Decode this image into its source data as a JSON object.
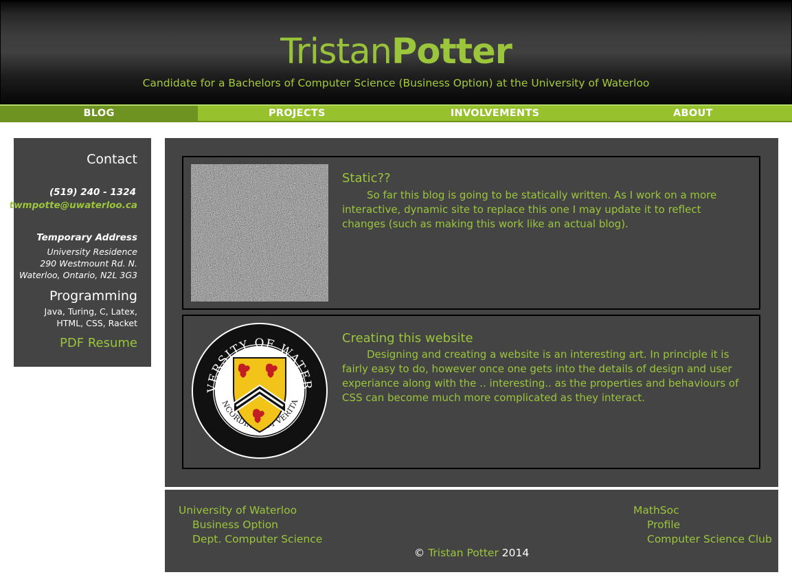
{
  "header": {
    "title_first": "Tristan",
    "title_last": "Potter",
    "tagline": "Candidate for a Bachelors of Computer Science (Business Option) at the University of Waterloo"
  },
  "nav": {
    "items": [
      {
        "label": "BLOG",
        "active": true
      },
      {
        "label": "PROJECTS",
        "active": false
      },
      {
        "label": "INVOLVEMENTS",
        "active": false
      },
      {
        "label": "ABOUT",
        "active": false
      }
    ]
  },
  "sidebar": {
    "contact_heading": "Contact",
    "phone": "(519) 240 - 1324",
    "email": "twmpotte@uwaterloo.ca",
    "address_heading": "Temporary Address",
    "address_lines": [
      "University Residence",
      "290 Westmount Rd. N.",
      "Waterloo, Ontario, N2L 3G3"
    ],
    "programming_heading": "Programming",
    "programming_text": "Java, Turing, C, Latex, HTML, CSS, Racket",
    "resume_link": "PDF Resume"
  },
  "posts": [
    {
      "title": "Static??",
      "body": "So far this blog is going to be statically written. As I work on a more interactive, dynamic site to replace this one I may update it to reflect changes (such as making this work like an actual blog).",
      "image": "static-noise-image"
    },
    {
      "title": "Creating this website",
      "body": "Designing and creating a website is an interesting art. In principle it is fairly easy to do, however once one gets into the details of design and user experiance along with the .. interesting.. as the properties and behaviours of CSS can become much more complicated as they interact.",
      "image": "university-of-waterloo-seal",
      "seal_text_top": "UNIVERSITY OF WATERLOO",
      "seal_text_bottom": "CONCORDIA CUM VERITATE"
    }
  ],
  "footer": {
    "left": {
      "title": "University of Waterloo",
      "links": [
        "Business Option",
        "Dept. Computer Science"
      ]
    },
    "right": {
      "title": "MathSoc",
      "links": [
        "Profile",
        "Computer Science Club"
      ]
    },
    "copyright_symbol": "©",
    "copyright_name": "Tristan Potter",
    "copyright_year": "2014"
  },
  "colors": {
    "accent": "#9bc63b",
    "nav_active": "#6e9320",
    "panel": "#444444"
  }
}
